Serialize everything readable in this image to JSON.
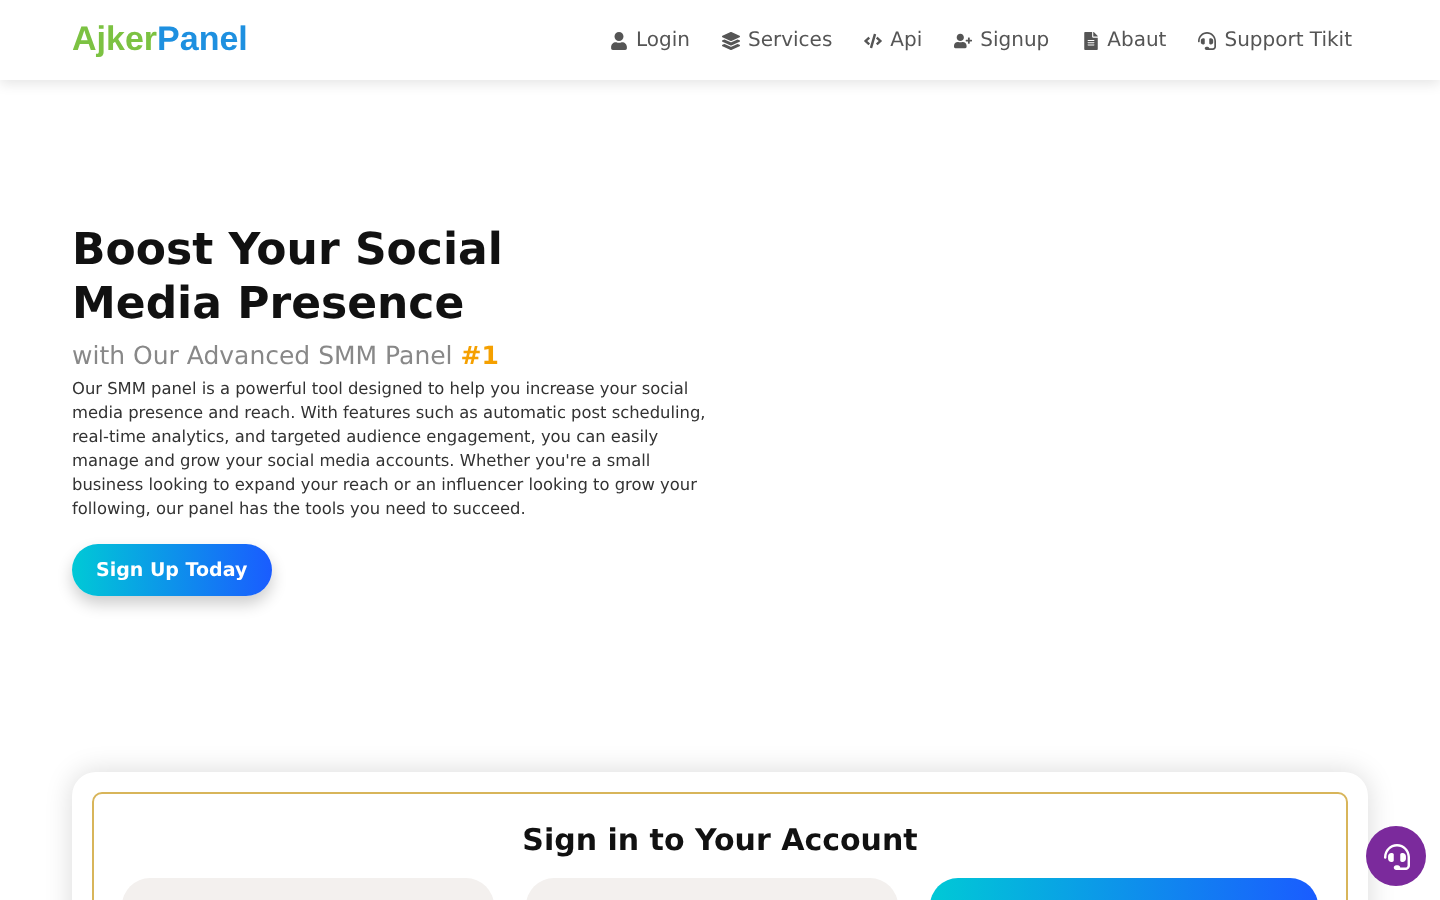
{
  "logo": {
    "part_1": "Ajker",
    "part_2": "Panel"
  },
  "nav": [
    {
      "label": "Login"
    },
    {
      "label": "Services"
    },
    {
      "label": "Api"
    },
    {
      "label": "Signup"
    },
    {
      "label": "Abaut"
    },
    {
      "label": "Support Tikit"
    }
  ],
  "hero": {
    "title": "Boost Your Social Media Presence",
    "subtitle": "with Our Advanced SMM Panel **#1**",
    "body": "Our SMM panel is a powerful tool designed to help you increase your social media presence and reach. With features such as automatic post scheduling, real-time analytics, and targeted audience engagement, you can easily manage and grow your social media accounts. Whether you're a small business looking to expand your reach or an influencer looking to grow your following, our panel has the tools you need to succeed.",
    "button": "Sign Up Today"
  },
  "signin": {
    "title": "Sign in to Your Account"
  }
}
